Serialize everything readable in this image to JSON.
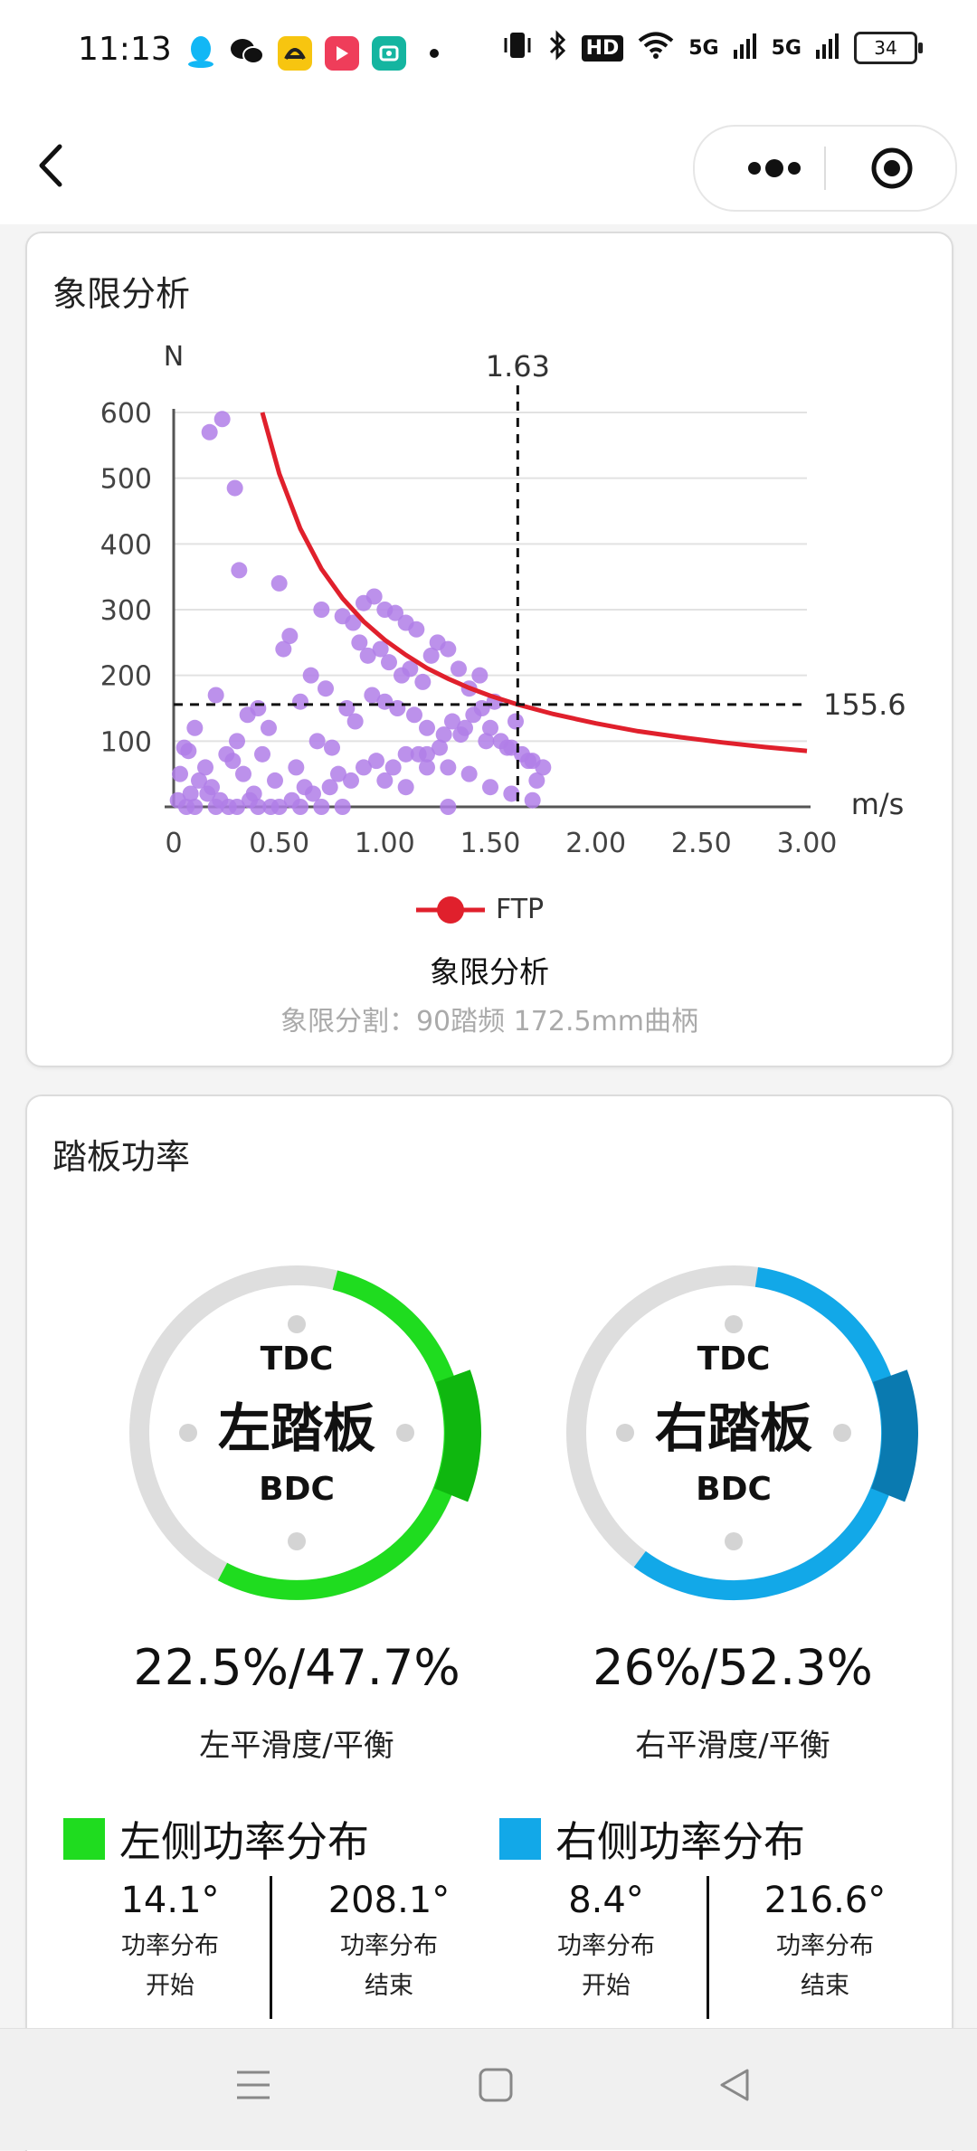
{
  "status_bar": {
    "time": "11:13",
    "battery": "34",
    "hd_badge": "HD",
    "signal_1": "5G",
    "signal_2": "5G",
    "icons": [
      "qq-icon",
      "wechat-icon",
      "app-yellow-icon",
      "video-red-icon",
      "mi-home-icon",
      "vibrate-icon",
      "bluetooth-icon",
      "wifi-icon"
    ]
  },
  "nav": {
    "back_icon": "chevron-left-icon",
    "more_icon": "more-dots-icon",
    "close_icon": "target-circle-icon"
  },
  "quadrant_card": {
    "title": "象限分析",
    "legend_label": "FTP",
    "caption": "象限分析",
    "note": "象限分割：90踏频 172.5mm曲柄",
    "ftp_color": "#e0202c",
    "point_color": "#b07ee8"
  },
  "chart_data": {
    "type": "scatter",
    "title": "",
    "xlabel": "m/s",
    "ylabel": "N",
    "xlim": [
      0,
      3.0
    ],
    "ylim": [
      0,
      600
    ],
    "x_ticks": [
      "0",
      "0.50",
      "1.00",
      "1.50",
      "2.00",
      "2.50",
      "3.00"
    ],
    "y_ticks": [
      "100",
      "200",
      "300",
      "400",
      "500",
      "600"
    ],
    "grid": true,
    "crosshair": {
      "x": 1.63,
      "y": 155.6,
      "x_label": "1.63",
      "y_label": "155.6"
    },
    "series": [
      {
        "name": "FTP",
        "type": "line",
        "x": [
          0.42,
          0.5,
          0.6,
          0.7,
          0.8,
          0.9,
          1.0,
          1.1,
          1.2,
          1.3,
          1.4,
          1.5,
          1.63,
          1.8,
          2.0,
          2.2,
          2.4,
          2.6,
          2.8,
          3.0
        ],
        "y": [
          600,
          507,
          423,
          362,
          317,
          282,
          254,
          231,
          211,
          195,
          181,
          169,
          155.6,
          141,
          127,
          115,
          106,
          98,
          91,
          85
        ]
      },
      {
        "type": "scatter",
        "x": [
          0.17,
          0.23,
          0.29,
          0.31,
          0.07,
          0.5,
          0.55,
          0.52,
          0.65,
          0.6,
          0.7,
          0.72,
          0.8,
          0.85,
          0.9,
          0.95,
          1.0,
          1.05,
          1.1,
          1.15,
          0.88,
          0.92,
          0.98,
          1.02,
          1.08,
          1.12,
          1.18,
          1.22,
          1.25,
          1.3,
          1.35,
          1.4,
          0.82,
          0.86,
          0.94,
          1.0,
          1.06,
          1.14,
          1.2,
          1.28,
          1.32,
          1.38,
          1.42,
          1.46,
          1.5,
          1.55,
          1.6,
          1.65,
          1.7,
          1.75,
          0.4,
          0.45,
          0.35,
          0.3,
          0.25,
          0.2,
          0.15,
          0.1,
          0.05,
          0.03,
          0.08,
          0.12,
          0.18,
          0.22,
          0.28,
          0.33,
          0.38,
          0.42,
          0.48,
          0.58,
          0.62,
          0.68,
          0.75,
          0.78,
          0.9,
          1.0,
          1.1,
          1.2,
          1.3,
          1.4,
          1.5,
          1.6,
          1.7,
          1.72,
          1.68,
          1.58,
          1.48,
          1.36,
          1.26,
          1.16,
          1.04,
          0.96,
          0.84,
          0.74,
          0.66,
          0.56,
          0.46,
          0.36,
          0.26,
          0.16,
          0.06,
          0.02,
          0.1,
          0.2,
          0.3,
          0.4,
          0.5,
          0.6,
          0.7,
          0.8,
          1.45,
          1.52,
          1.62,
          1.1,
          1.2,
          1.3
        ],
        "y": [
          570,
          590,
          485,
          360,
          85,
          340,
          260,
          240,
          200,
          160,
          300,
          180,
          290,
          280,
          310,
          320,
          300,
          295,
          280,
          270,
          250,
          230,
          240,
          220,
          200,
          210,
          190,
          230,
          250,
          240,
          210,
          180,
          150,
          130,
          170,
          160,
          150,
          140,
          120,
          110,
          130,
          120,
          140,
          150,
          120,
          100,
          90,
          80,
          70,
          60,
          150,
          120,
          140,
          100,
          80,
          170,
          60,
          120,
          90,
          50,
          20,
          40,
          30,
          10,
          70,
          50,
          20,
          80,
          40,
          60,
          30,
          100,
          90,
          50,
          60,
          40,
          30,
          80,
          60,
          50,
          30,
          20,
          10,
          40,
          70,
          90,
          100,
          110,
          90,
          80,
          60,
          70,
          40,
          30,
          20,
          10,
          0,
          10,
          0,
          20,
          0,
          10,
          0,
          0,
          0,
          0,
          0,
          0,
          0,
          0,
          200,
          160,
          130,
          80,
          60,
          0
        ]
      }
    ]
  },
  "pedal_card": {
    "title": "踏板功率",
    "left": {
      "tdc": "TDC",
      "name": "左踏板",
      "bdc": "BDC",
      "value": "22.5%/47.7%",
      "label": "左平滑度/平衡",
      "dist_title": "左侧功率分布",
      "start_value": "14.1°",
      "start_label_1": "功率分布",
      "start_label_2": "开始",
      "end_value": "208.1°",
      "end_label_1": "功率分布",
      "end_label_2": "结束",
      "color": "#1fdc1f",
      "peak_color": "#0fb70f",
      "start_deg": 14.1,
      "end_deg": 208.1,
      "peak_start_deg": 70,
      "peak_end_deg": 112
    },
    "right": {
      "tdc": "TDC",
      "name": "右踏板",
      "bdc": "BDC",
      "value": "26%/52.3%",
      "label": "右平滑度/平衡",
      "dist_title": "右侧功率分布",
      "start_value": "8.4°",
      "start_label_1": "功率分布",
      "start_label_2": "开始",
      "end_value": "216.6°",
      "end_label_1": "功率分布",
      "end_label_2": "结束",
      "color": "#12a8e8",
      "peak_color": "#0a7ab0",
      "start_deg": 8.4,
      "end_deg": 216.6,
      "peak_start_deg": 70,
      "peak_end_deg": 112
    }
  },
  "sys_nav": {
    "menu_icon": "menu-icon",
    "home_icon": "home-square-icon",
    "back_icon": "back-triangle-icon"
  }
}
